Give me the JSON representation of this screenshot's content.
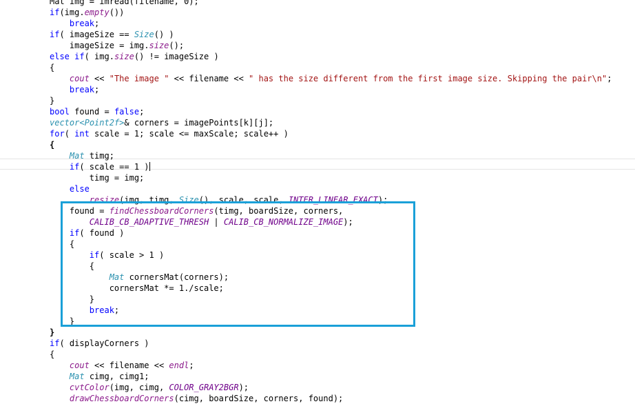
{
  "editor": {
    "colors": {
      "keyword": "#0000ff",
      "type": "#2b91af",
      "function": "#8b1a8b",
      "macro": "#6f008a",
      "string": "#a31515",
      "highlight_border": "#1aa0d8"
    },
    "lines": [
      [
        {
          "t": "Mat img = imread(filename, 0);"
        }
      ],
      [
        {
          "t": "if",
          "c": "kw"
        },
        {
          "t": "(img."
        },
        {
          "t": "empty",
          "c": "fn"
        },
        {
          "t": "())"
        }
      ],
      [
        {
          "t": "    "
        },
        {
          "t": "break",
          "c": "kw"
        },
        {
          "t": ";"
        }
      ],
      [
        {
          "t": "if",
          "c": "kw"
        },
        {
          "t": "( imageSize == "
        },
        {
          "t": "Size",
          "c": "ty"
        },
        {
          "t": "() )"
        }
      ],
      [
        {
          "t": "    imageSize = img."
        },
        {
          "t": "size",
          "c": "fn"
        },
        {
          "t": "();"
        }
      ],
      [
        {
          "t": "else",
          "c": "kw"
        },
        {
          "t": " "
        },
        {
          "t": "if",
          "c": "kw"
        },
        {
          "t": "( img."
        },
        {
          "t": "size",
          "c": "fn"
        },
        {
          "t": "() != imageSize )"
        }
      ],
      [
        {
          "t": "{"
        }
      ],
      [
        {
          "t": "    "
        },
        {
          "t": "cout",
          "c": "fn"
        },
        {
          "t": " << "
        },
        {
          "t": "\"The image \"",
          "c": "st"
        },
        {
          "t": " << filename << "
        },
        {
          "t": "\" has the size different from the first image size. Skipping the pair\\n\"",
          "c": "st"
        },
        {
          "t": ";"
        }
      ],
      [
        {
          "t": "    "
        },
        {
          "t": "break",
          "c": "kw"
        },
        {
          "t": ";"
        }
      ],
      [
        {
          "t": "}"
        }
      ],
      [
        {
          "t": "bool",
          "c": "kw"
        },
        {
          "t": " found = "
        },
        {
          "t": "false",
          "c": "kw"
        },
        {
          "t": ";"
        }
      ],
      [
        {
          "t": "vector",
          "c": "ty"
        },
        {
          "t": "<",
          "c": "ty"
        },
        {
          "t": "Point2f",
          "c": "ty"
        },
        {
          "t": ">",
          "c": "ty"
        },
        {
          "t": "& corners = imagePoints[k][j];"
        }
      ],
      [
        {
          "t": "for",
          "c": "kw"
        },
        {
          "t": "( "
        },
        {
          "t": "int",
          "c": "kw"
        },
        {
          "t": " scale = 1; scale <= maxScale; scale++ )"
        }
      ],
      [
        {
          "t": "{",
          "c": "bd"
        }
      ],
      [
        {
          "t": "    "
        },
        {
          "t": "Mat",
          "c": "ty"
        },
        {
          "t": " timg;"
        }
      ],
      [
        {
          "t": "    "
        },
        {
          "t": "if",
          "c": "kw"
        },
        {
          "t": "( scale == 1 )"
        },
        {
          "caret": true
        }
      ],
      [
        {
          "t": "        timg = img;"
        }
      ],
      [
        {
          "t": "    "
        },
        {
          "t": "else",
          "c": "kw"
        }
      ],
      [
        {
          "t": "        "
        },
        {
          "t": "resize",
          "c": "fn"
        },
        {
          "t": "(img, timg, "
        },
        {
          "t": "Size",
          "c": "ty"
        },
        {
          "t": "(), scale, scale, "
        },
        {
          "t": "INTER_LINEAR_EXACT",
          "c": "mc"
        },
        {
          "t": ");"
        }
      ],
      [
        {
          "t": "    found = "
        },
        {
          "t": "findChessboardCorners",
          "c": "fn"
        },
        {
          "t": "(timg, boardSize, corners,"
        }
      ],
      [
        {
          "t": "        "
        },
        {
          "t": "CALIB_CB_ADAPTIVE_THRESH",
          "c": "mc"
        },
        {
          "t": " | "
        },
        {
          "t": "CALIB_CB_NORMALIZE_IMAGE",
          "c": "mc"
        },
        {
          "t": ");"
        }
      ],
      [
        {
          "t": "    "
        },
        {
          "t": "if",
          "c": "kw"
        },
        {
          "t": "( found )"
        }
      ],
      [
        {
          "t": "    {"
        }
      ],
      [
        {
          "t": "        "
        },
        {
          "t": "if",
          "c": "kw"
        },
        {
          "t": "( scale > 1 )"
        }
      ],
      [
        {
          "t": "        {"
        }
      ],
      [
        {
          "t": "            "
        },
        {
          "t": "Mat",
          "c": "ty"
        },
        {
          "t": " cornersMat(corners);"
        }
      ],
      [
        {
          "t": "            cornersMat *= 1./scale;"
        }
      ],
      [
        {
          "t": "        }"
        }
      ],
      [
        {
          "t": "        "
        },
        {
          "t": "break",
          "c": "kw"
        },
        {
          "t": ";"
        }
      ],
      [
        {
          "t": "    }"
        }
      ],
      [
        {
          "t": "}",
          "c": "bd"
        }
      ],
      [
        {
          "t": "if",
          "c": "kw"
        },
        {
          "t": "( displayCorners )"
        }
      ],
      [
        {
          "t": "{"
        }
      ],
      [
        {
          "t": "    "
        },
        {
          "t": "cout",
          "c": "fn"
        },
        {
          "t": " << filename << "
        },
        {
          "t": "endl",
          "c": "fn"
        },
        {
          "t": ";"
        }
      ],
      [
        {
          "t": "    "
        },
        {
          "t": "Mat",
          "c": "ty"
        },
        {
          "t": " cimg, cimg1;"
        }
      ],
      [
        {
          "t": "    "
        },
        {
          "t": "cvtColor",
          "c": "fn"
        },
        {
          "t": "(img, cimg, "
        },
        {
          "t": "COLOR_GRAY2BGR",
          "c": "mc"
        },
        {
          "t": ");"
        }
      ],
      [
        {
          "t": "    "
        },
        {
          "t": "drawChessboardCorners",
          "c": "fn"
        },
        {
          "t": "(cimg, boardSize, corners, found);"
        }
      ]
    ]
  }
}
